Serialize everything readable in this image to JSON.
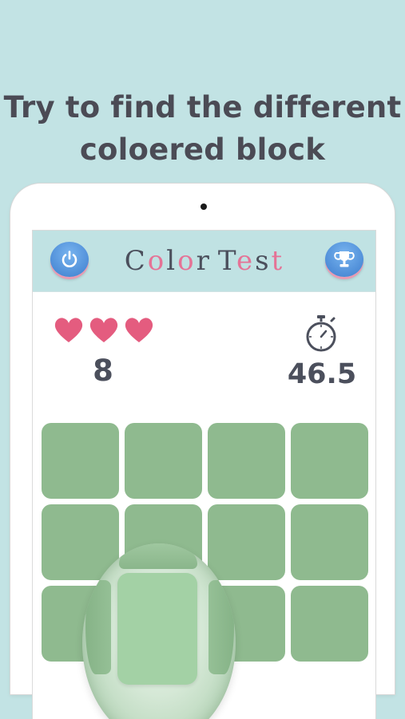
{
  "headline": {
    "line1": "Try to find the different",
    "line2": "coloered block"
  },
  "app": {
    "title_letters": [
      {
        "ch": "C",
        "color": "#4b4f5c"
      },
      {
        "ch": "o",
        "color": "#e57396"
      },
      {
        "ch": "l",
        "color": "#4b4f5c"
      },
      {
        "ch": "o",
        "color": "#e57396"
      },
      {
        "ch": "r",
        "color": "#4b4f5c"
      },
      {
        "ch": " ",
        "color": "#4b4f5c"
      },
      {
        "ch": "T",
        "color": "#4b4f5c"
      },
      {
        "ch": "e",
        "color": "#e57396"
      },
      {
        "ch": "s",
        "color": "#4b4f5c"
      },
      {
        "ch": "t",
        "color": "#e57396"
      }
    ],
    "power_icon": "power-icon",
    "trophy_icon": "trophy-icon"
  },
  "status": {
    "lives": 3,
    "score": "8",
    "timer": "46.5",
    "timer_icon": "stopwatch-icon"
  },
  "board": {
    "rows": 3,
    "cols": 4,
    "tile_color": "#8fba8f",
    "odd_tile_color": "#a3d1a5"
  },
  "colors": {
    "background": "#c2e3e4",
    "heart": "#e45c7f",
    "button": "#5a9be2"
  }
}
